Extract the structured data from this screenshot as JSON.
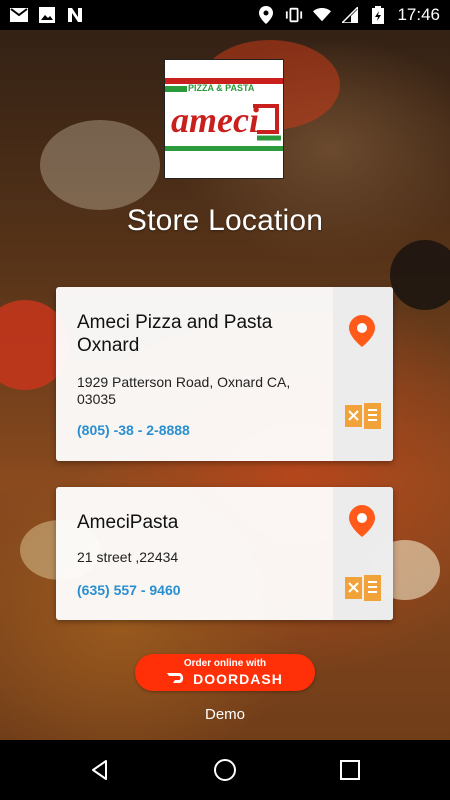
{
  "status_bar": {
    "time": "17:46",
    "left_icons": [
      "gmail-icon",
      "image-icon",
      "n-icon"
    ],
    "right_icons": [
      "location-icon",
      "vibrate-icon",
      "wifi-icon",
      "signal-icon",
      "battery-icon"
    ]
  },
  "logo": {
    "line1": "PIZZA & PASTA",
    "line2": "ameci"
  },
  "page_title": "Store Location",
  "stores": [
    {
      "name": "Ameci Pizza and Pasta Oxnard",
      "address": "1929 Patterson Road, Oxnard CA, 03035",
      "phone": "(805) -38 - 2-8888"
    },
    {
      "name": "AmeciPasta",
      "address": "21 street ,22434",
      "phone": "(635) 557 - 9460"
    }
  ],
  "doordash": {
    "top_text": "Order online with",
    "brand_text": "DOORDASH"
  },
  "footer_label": "Demo",
  "colors": {
    "accent": "#ff5a1a",
    "phone": "#2a8fd0",
    "doordash": "#ff3008",
    "menu_icon": "#f2a23a"
  },
  "nav_bar": [
    "back-icon",
    "home-icon",
    "recents-icon"
  ]
}
